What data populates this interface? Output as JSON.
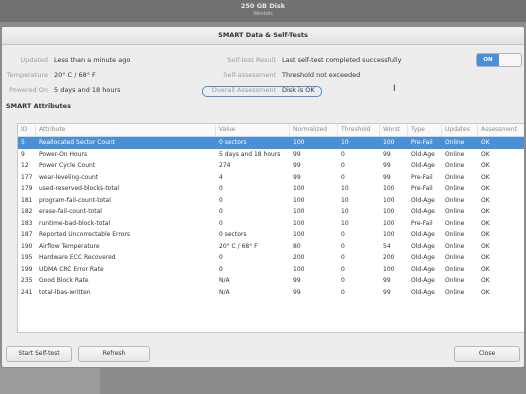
{
  "window": {
    "title": "250 GB Disk",
    "subtitle": "Westdis"
  },
  "dialog": {
    "title": "SMART Data & Self-Tests"
  },
  "info": {
    "updated_label": "Updated",
    "updated_value": "Less than a minute ago",
    "temperature_label": "Temperature",
    "temperature_value": "20° C / 68° F",
    "powered_on_label": "Powered On",
    "powered_on_value": "5 days and 18 hours",
    "self_test_result_label": "Self-test Result",
    "self_test_result_value": "Last self-test completed successfully",
    "self_assessment_label": "Self-assessment",
    "self_assessment_value": "Threshold not exceeded",
    "overall_assessment_label": "Overall Assessment",
    "overall_assessment_value": "Disk is OK"
  },
  "toggle": {
    "label": "ON"
  },
  "section_title": "SMART Attributes",
  "table": {
    "headers": [
      "ID",
      "Attribute",
      "Value",
      "Normalized",
      "Threshold",
      "Worst",
      "Type",
      "Updates",
      "Assessment"
    ],
    "rows": [
      [
        "5",
        "Reallocated Sector Count",
        "0 sectors",
        "100",
        "10",
        "100",
        "Pre-Fail",
        "Online",
        "OK"
      ],
      [
        "9",
        "Power-On Hours",
        "5 days and 18 hours",
        "99",
        "0",
        "99",
        "Old-Age",
        "Online",
        "OK"
      ],
      [
        "12",
        "Power Cycle Count",
        "274",
        "99",
        "0",
        "99",
        "Old-Age",
        "Online",
        "OK"
      ],
      [
        "177",
        "wear-leveling-count",
        "4",
        "99",
        "0",
        "99",
        "Pre-Fail",
        "Online",
        "OK"
      ],
      [
        "179",
        "used-reserved-blocks-total",
        "0",
        "100",
        "10",
        "100",
        "Pre-Fail",
        "Online",
        "OK"
      ],
      [
        "181",
        "program-fail-count-total",
        "0",
        "100",
        "10",
        "100",
        "Old-Age",
        "Online",
        "OK"
      ],
      [
        "182",
        "erase-fail-count-total",
        "0",
        "100",
        "10",
        "100",
        "Old-Age",
        "Online",
        "OK"
      ],
      [
        "183",
        "runtime-bad-block-total",
        "0",
        "100",
        "10",
        "100",
        "Pre-Fail",
        "Online",
        "OK"
      ],
      [
        "187",
        "Reported Uncorrectable Errors",
        "0 sectors",
        "100",
        "0",
        "100",
        "Old-Age",
        "Online",
        "OK"
      ],
      [
        "190",
        "Airflow Temperature",
        "20° C / 68° F",
        "80",
        "0",
        "54",
        "Old-Age",
        "Online",
        "OK"
      ],
      [
        "195",
        "Hardware ECC Recovered",
        "0",
        "200",
        "0",
        "200",
        "Old-Age",
        "Online",
        "OK"
      ],
      [
        "199",
        "UDMA CRC Error Rate",
        "0",
        "100",
        "0",
        "100",
        "Old-Age",
        "Online",
        "OK"
      ],
      [
        "235",
        "Good Block Rate",
        "N/A",
        "99",
        "0",
        "99",
        "Old-Age",
        "Online",
        "OK"
      ],
      [
        "241",
        "total-lbas-written",
        "N/A",
        "99",
        "0",
        "99",
        "Old-Age",
        "Online",
        "OK"
      ]
    ],
    "selected_row": 0
  },
  "buttons": {
    "start_self_test": "Start Self-test",
    "refresh": "Refresh",
    "close": "Close"
  },
  "colors": {
    "accent": "#4a90d9",
    "dialog_bg": "#ededed",
    "label_gray": "#9a9c99"
  }
}
